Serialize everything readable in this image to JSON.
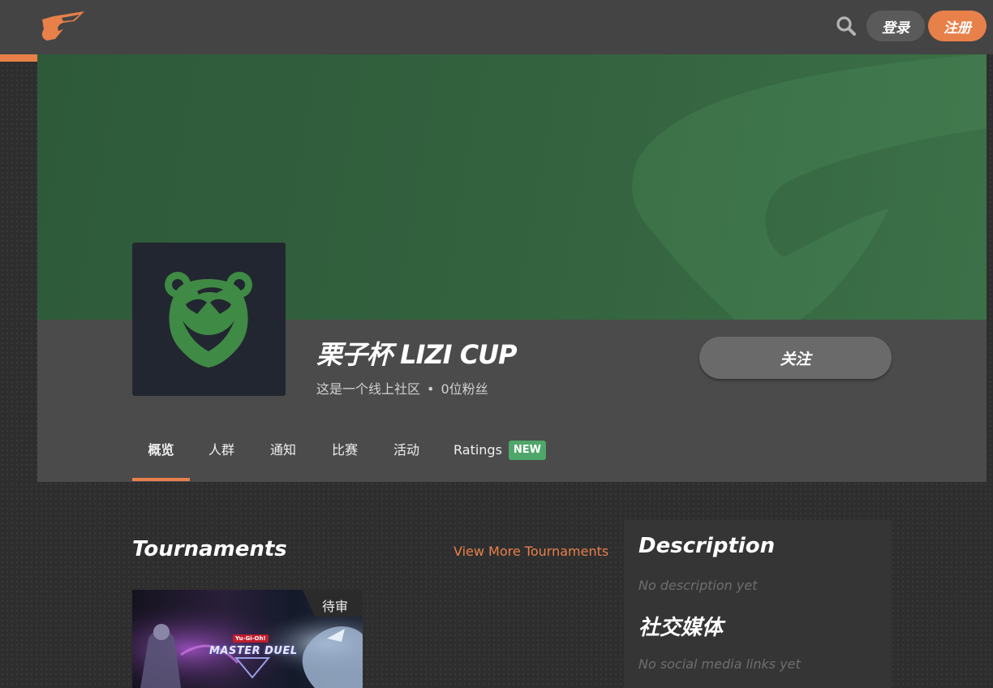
{
  "header": {
    "logo_icon": "site-logo-icon",
    "search_icon": "search-icon",
    "login_label": "登录",
    "register_label": "注册"
  },
  "colors": {
    "accent": "#e8804a",
    "topbar": "#444444",
    "banner": "#33633f",
    "panel": "#4b4b4b",
    "badge_new": "#4fa66a"
  },
  "community": {
    "name": "栗子杯 LIZI CUP",
    "type": "这是一个线上社区",
    "separator": "•",
    "followers": "0位粉丝",
    "follow_label": "关注",
    "avatar_icon": "bear-logo-icon"
  },
  "tabs": [
    {
      "label": "概览",
      "active": true
    },
    {
      "label": "人群"
    },
    {
      "label": "通知"
    },
    {
      "label": "比赛"
    },
    {
      "label": "活动"
    },
    {
      "label": "Ratings",
      "badge": "NEW"
    }
  ],
  "tournaments": {
    "title": "Tournaments",
    "view_more": "View More Tournaments",
    "cards": [
      {
        "status": "待审",
        "game_logo": "MASTER DUEL",
        "game_logo_top": "Yu-Gi-Oh!"
      }
    ]
  },
  "sidebar": {
    "description_title": "Description",
    "description_empty": "No description yet",
    "social_title": "社交媒体",
    "social_empty": "No social media links yet"
  }
}
